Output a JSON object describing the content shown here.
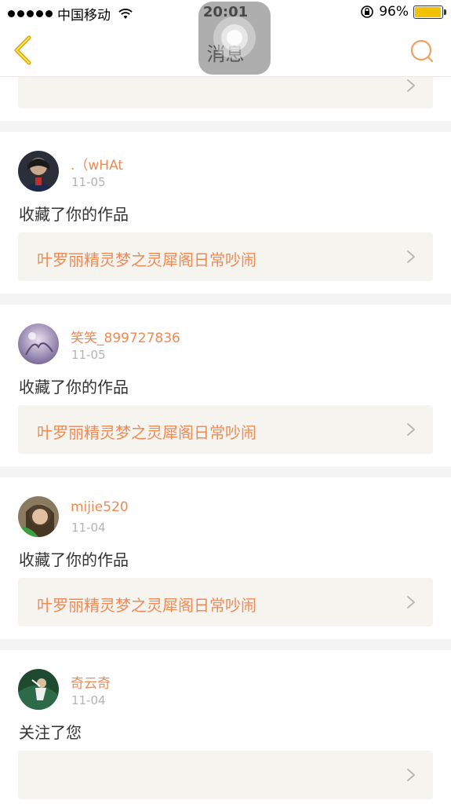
{
  "status_bar": {
    "carrier": "中国移动",
    "time": "20:01",
    "battery_percent": "96%",
    "battery_level": 0.96,
    "battery_color": "#f2c200"
  },
  "nav": {
    "title": "消息",
    "back_icon": "chevron-left-icon",
    "search_icon": "search-icon",
    "accent_color": "#f0a060"
  },
  "messages": [
    {
      "username": ".（wHAt",
      "date": "11-05",
      "action": "收藏了你的作品",
      "work_title": "叶罗丽精灵梦之灵犀阁日常吵闹"
    },
    {
      "username": "笑笑_899727836",
      "date": "11-05",
      "action": "收藏了你的作品",
      "work_title": "叶罗丽精灵梦之灵犀阁日常吵闹"
    },
    {
      "username": "mijie520",
      "date": "11-04",
      "action": "收藏了你的作品",
      "work_title": "叶罗丽精灵梦之灵犀阁日常吵闹"
    },
    {
      "username": "奇云奇",
      "date": "11-04",
      "action": "关注了您",
      "work_title": ""
    }
  ],
  "colors": {
    "username": "#ef8a55",
    "card_background": "#f5f4ef",
    "separator": "#f4f4f4"
  }
}
